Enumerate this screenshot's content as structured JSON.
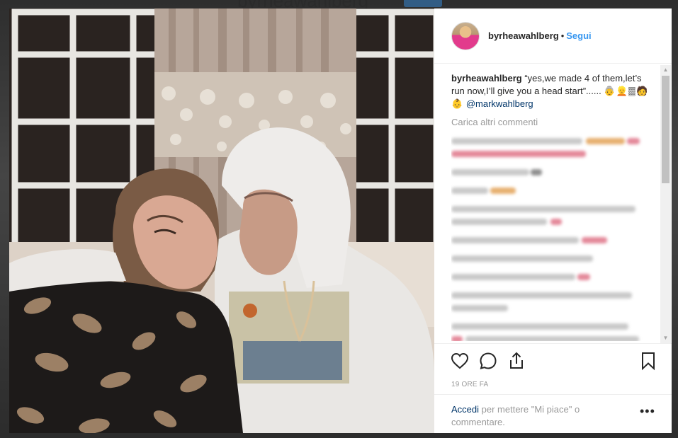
{
  "background": {
    "username_ghost": "byrheawahlberg",
    "follow_ghost": "Segui"
  },
  "post": {
    "username": "byrheawahlberg",
    "separator": "•",
    "follow_label": "Segui",
    "caption": {
      "user": "byrheawahlberg",
      "text": "“yes,we made 4 of them,let’s run now,I’ll give you a head start”......",
      "emojis": "👵👱🀡🧑👶",
      "mention": "@markwahlberg"
    },
    "load_more": "Carica altri commenti",
    "timestamp": "19 ORE FA",
    "login": {
      "link": "Accedi",
      "rest": " per mettere \"Mi piace\" o commentare."
    },
    "more_glyph": "•••"
  },
  "colors": {
    "accent": "#3897f0",
    "link": "#003569",
    "muted": "#999999",
    "text": "#262626"
  },
  "icons": {
    "like": "heart-icon",
    "comment": "comment-icon",
    "share": "share-icon",
    "save": "bookmark-icon",
    "more": "more-icon"
  }
}
